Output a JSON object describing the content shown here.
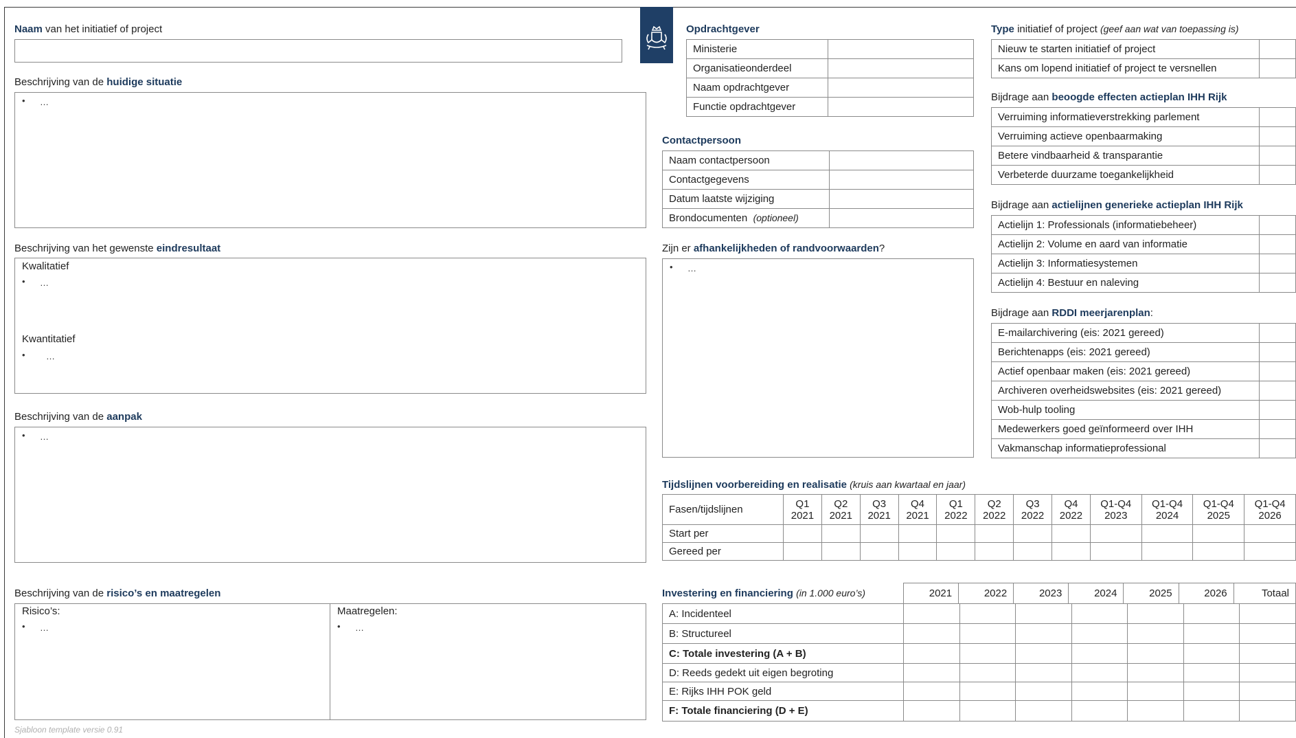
{
  "left": {
    "naam": {
      "bold": "Naam",
      "rest": " van het initiatief of project"
    },
    "huidig": {
      "pre": "Beschrijving van de ",
      "bold": "huidige situatie"
    },
    "eind": {
      "pre": "Beschrijving van het gewenste ",
      "bold": "eindresultaat"
    },
    "kwalitatief": "Kwalitatief",
    "kwantitatief": "Kwantitatief",
    "aanpak": {
      "pre": "Beschrijving van de ",
      "bold": "aanpak"
    },
    "risico": {
      "pre": "Beschrijving van de ",
      "bold": "risico’s en maatregelen"
    },
    "risicos_label": "Risico’s:",
    "maatregelen_label": "Maatregelen:",
    "bullet": "•",
    "ellipsis": "…"
  },
  "opdrachtgever": {
    "title": "Opdrachtgever",
    "rows": [
      "Ministerie",
      "Organisatieonderdeel",
      "Naam opdrachtgever",
      "Functie opdrachtgever"
    ]
  },
  "contactpersoon": {
    "title": "Contactpersoon",
    "rows": [
      "Naam contactpersoon",
      "Contactgegevens",
      "Datum laatste wijziging"
    ],
    "bron": "Brondocumenten",
    "bron_opt": "(optioneel)"
  },
  "afhankelijk": {
    "pre": "Zijn er ",
    "bold": "afhankelijkheden of randvoorwaarden",
    "post": "?"
  },
  "type": {
    "bold": "Type",
    "rest": " initiatief of project ",
    "italic": "(geef aan wat van toepassing is)",
    "rows": [
      "Nieuw te starten initiatief of project",
      "Kans om lopend initiatief of project te versnellen"
    ]
  },
  "effecten": {
    "pre": "Bijdrage aan ",
    "bold": "beoogde effecten actieplan IHH Rijk",
    "rows": [
      "Verruiming informatieverstrekking parlement",
      "Verruiming actieve openbaarmaking",
      "Betere vindbaarheid & transparantie",
      "Verbeterde duurzame toegankelijkheid"
    ]
  },
  "actielijnen": {
    "pre": "Bijdrage aan ",
    "bold": "actielijnen generieke actieplan IHH Rijk",
    "rows": [
      "Actielijn 1: Professionals (informatiebeheer)",
      "Actielijn 2: Volume en aard van informatie",
      "Actielijn 3: Informatiesystemen",
      "Actielijn 4: Bestuur en naleving"
    ]
  },
  "rddi": {
    "pre": "Bijdrage aan ",
    "bold": "RDDI meerjarenplan",
    "post": ":",
    "rows": [
      "E-mailarchivering (eis: 2021 gereed)",
      "Berichtenapps (eis: 2021 gereed)",
      "Actief openbaar maken (eis: 2021 gereed)",
      "Archiveren overheidswebsites (eis: 2021 gereed)",
      "Wob-hulp tooling",
      "Medewerkers goed geïnformeerd over IHH",
      "Vakmanschap informatieprofessional"
    ]
  },
  "tijdslijnen": {
    "bold": "Tijdslijnen voorbereiding en realisatie",
    "italic": "(kruis aan kwartaal en jaar)",
    "corner": "Fasen/tijdslijnen",
    "cols": [
      [
        "Q1",
        "2021"
      ],
      [
        "Q2",
        "2021"
      ],
      [
        "Q3",
        "2021"
      ],
      [
        "Q4",
        "2021"
      ],
      [
        "Q1",
        "2022"
      ],
      [
        "Q2",
        "2022"
      ],
      [
        "Q3",
        "2022"
      ],
      [
        "Q4",
        "2022"
      ],
      [
        "Q1-Q4",
        "2023"
      ],
      [
        "Q1-Q4",
        "2024"
      ],
      [
        "Q1-Q4",
        "2025"
      ],
      [
        "Q1-Q4",
        "2026"
      ]
    ],
    "rows": [
      "Start per",
      "Gereed per"
    ]
  },
  "investering": {
    "bold": "Investering en financiering",
    "italic": "(in 1.000 euro’s)",
    "years": [
      "2021",
      "2022",
      "2023",
      "2024",
      "2025",
      "2026",
      "Totaal"
    ],
    "rows": [
      {
        "label": "A: Incidenteel",
        "bold": false
      },
      {
        "label": "B: Structureel",
        "bold": false
      },
      {
        "label": "C: Totale investering (A + B)",
        "bold": true
      },
      {
        "label": "D: Reeds gedekt uit eigen begroting",
        "bold": false
      },
      {
        "label": "E: Rijks IHH POK geld",
        "bold": false
      },
      {
        "label": "F: Totale financiering (D + E)",
        "bold": true
      }
    ]
  },
  "footer": "Sjabloon template versie 0.91",
  "colors": {
    "accent": "#1d3a5c",
    "emblem_bg": "#1f3f66",
    "border": "#8a8a8a"
  }
}
